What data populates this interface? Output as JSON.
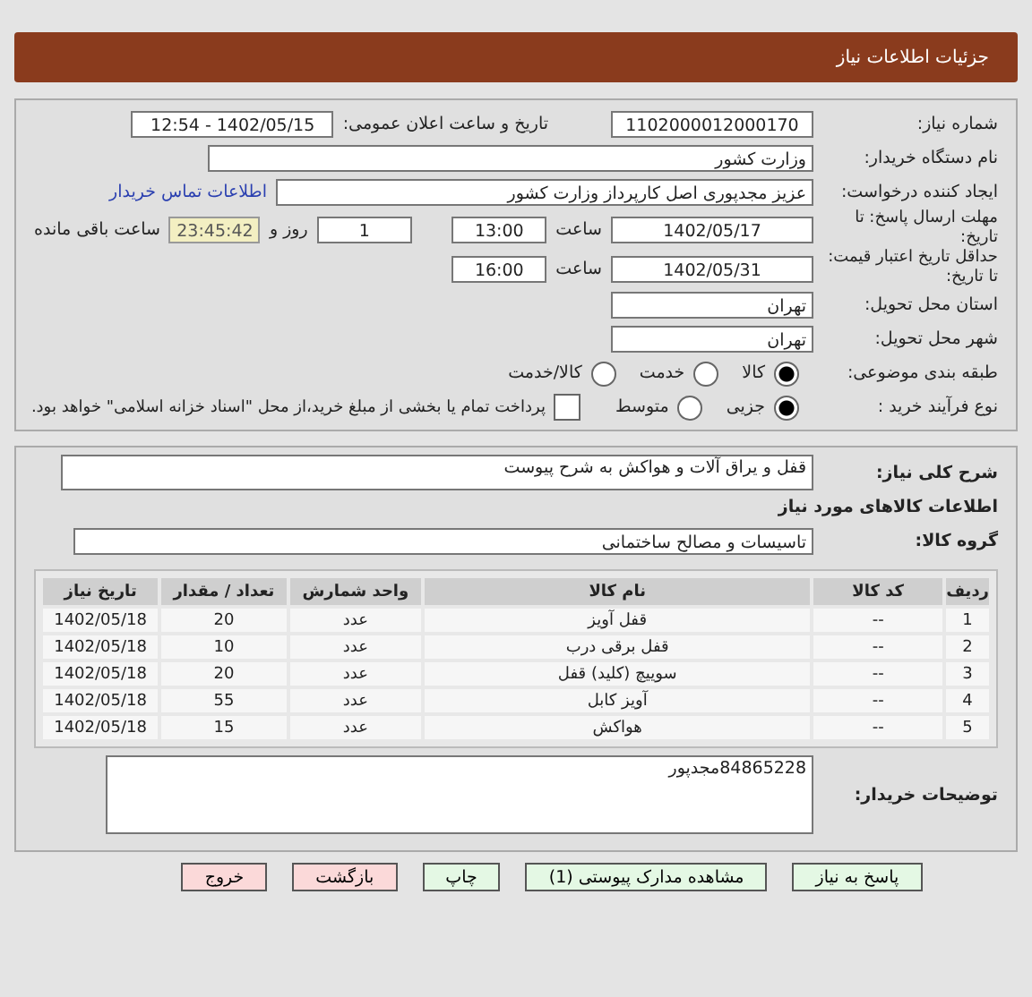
{
  "header": {
    "title": "جزئیات اطلاعات نیاز"
  },
  "info": {
    "need_number": {
      "label": "شماره نیاز:",
      "value": "1102000012000170"
    },
    "announce": {
      "label": "تاریخ و ساعت اعلان عمومی:",
      "value": "1402/05/15 - 12:54"
    },
    "buyer": {
      "label": "نام دستگاه خریدار:",
      "value": "وزارت کشور"
    },
    "creator": {
      "label": "ایجاد کننده درخواست:",
      "value": "عزیز مجدپوری اصل کارپرداز وزارت کشور",
      "link": "اطلاعات تماس خریدار"
    },
    "deadline": {
      "label": "مهلت ارسال پاسخ: تا تاریخ:",
      "date": "1402/05/17",
      "time_label": "ساعت",
      "time": "13:00",
      "days": "1",
      "days_label": "روز و",
      "remaining": "23:45:42",
      "remaining_label": "ساعت باقی مانده"
    },
    "validity": {
      "label": "حداقل تاریخ اعتبار قیمت: تا تاریخ:",
      "date": "1402/05/31",
      "time_label": "ساعت",
      "time": "16:00"
    },
    "province": {
      "label": "استان محل تحویل:",
      "value": "تهران"
    },
    "city": {
      "label": "شهر محل تحویل:",
      "value": "تهران"
    },
    "category": {
      "label": "طبقه بندی موضوعی:",
      "options": [
        {
          "label": "کالا",
          "selected": true
        },
        {
          "label": "خدمت",
          "selected": false
        },
        {
          "label": "کالا/خدمت",
          "selected": false
        }
      ]
    },
    "process": {
      "label": "نوع فرآیند خرید :",
      "options": [
        {
          "label": "جزیی",
          "selected": true
        },
        {
          "label": "متوسط",
          "selected": false
        }
      ],
      "payment": {
        "label": "پرداخت تمام یا بخشی از مبلغ خرید،از محل \"اسناد خزانه اسلامی\" خواهد بود.",
        "checked": false
      }
    }
  },
  "details": {
    "description": {
      "label": "شرح کلی نیاز:",
      "value": "قفل و یراق آلات  و هواکش به شرح پیوست"
    },
    "goods_title": "اطلاعات کالاهای مورد نیاز",
    "group": {
      "label": "گروه کالا:",
      "value": "تاسیسات و مصالح ساختمانی"
    },
    "table": {
      "columns": [
        "ردیف",
        "کد کالا",
        "نام کالا",
        "واحد شمارش",
        "تعداد / مقدار",
        "تاریخ نیاز"
      ],
      "rows": [
        [
          "1",
          "--",
          "قفل آویز",
          "عدد",
          "20",
          "1402/05/18"
        ],
        [
          "2",
          "--",
          "قفل برقی درب",
          "عدد",
          "10",
          "1402/05/18"
        ],
        [
          "3",
          "--",
          "سوییچ (کلید) قفل",
          "عدد",
          "20",
          "1402/05/18"
        ],
        [
          "4",
          "--",
          "آویز کابل",
          "عدد",
          "55",
          "1402/05/18"
        ],
        [
          "5",
          "--",
          "هواکش",
          "عدد",
          "15",
          "1402/05/18"
        ]
      ]
    },
    "notes": {
      "label": "توضیحات خریدار:",
      "value": "84865228مجدپور"
    }
  },
  "buttons": [
    {
      "label": "پاسخ به نیاز",
      "kind": "green"
    },
    {
      "label": "مشاهده مدارک پیوستی (1)",
      "kind": "green"
    },
    {
      "label": "چاپ",
      "kind": "green"
    },
    {
      "label": "بازگشت",
      "kind": "red"
    },
    {
      "label": "خروج",
      "kind": "red"
    }
  ]
}
